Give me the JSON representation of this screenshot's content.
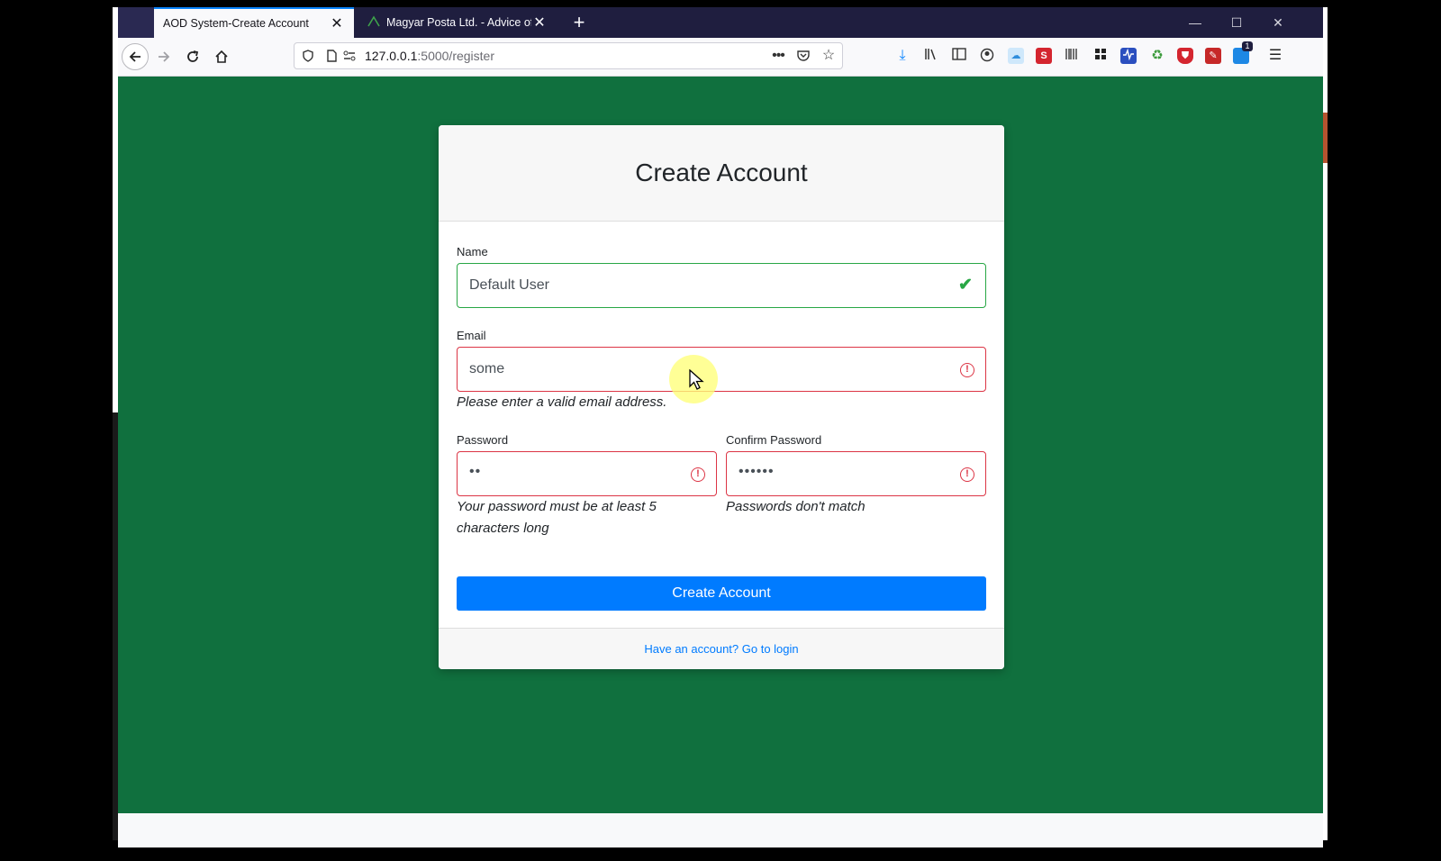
{
  "browser": {
    "tabs": [
      {
        "title": "AOD System-Create Account",
        "active": true
      },
      {
        "title": "Magyar Posta Ltd. - Advice of ",
        "active": false
      }
    ],
    "url": {
      "host": "127.0.0.1",
      "path": ":5000/register"
    },
    "extension_badge": "1"
  },
  "form": {
    "title": "Create Account",
    "name": {
      "label": "Name",
      "value": "Default User",
      "state": "valid"
    },
    "email": {
      "label": "Email",
      "value": "some",
      "state": "invalid",
      "feedback": "Please enter a valid email address."
    },
    "password": {
      "label": "Password",
      "value": "••",
      "state": "invalid",
      "feedback": "Your password must be at least 5 characters long"
    },
    "confirm_password": {
      "label": "Confirm Password",
      "value": "••••••",
      "state": "invalid",
      "feedback": "Passwords don't match"
    },
    "submit_label": "Create Account",
    "login_link": "Have an account? Go to login"
  },
  "colors": {
    "page_bg": "#10703e",
    "valid": "#28a745",
    "invalid": "#dc3545",
    "primary": "#007bff"
  }
}
